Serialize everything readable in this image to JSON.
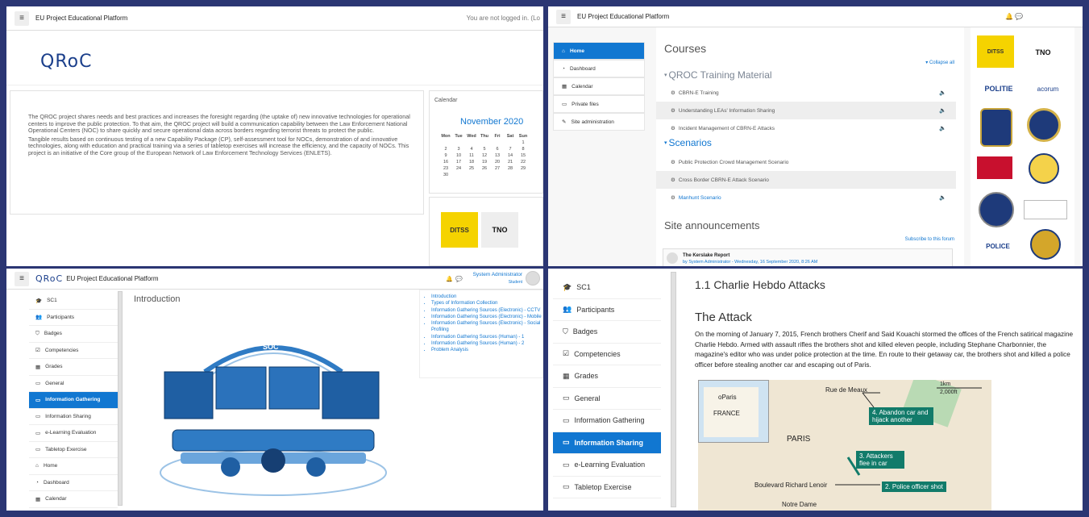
{
  "panel1": {
    "platform_title": "EU Project Educational Platform",
    "login_status": "You are not logged in. (Lo",
    "logo": "QRoC",
    "intro_p1": "The QROC project shares needs and best practices and increases the foresight regarding (the uptake of) new innovative technologies for operational centers to improve the public protection. To that aim, the QROC project will build a communication capability between the Law Enforcement National Operational Centers (NOC) to share quickly and secure operational data across borders regarding terrorist threats to protect the public.",
    "intro_p2": "Tangible results based on continuous testing of a new Capability Package (CP), self-assessment tool for NOCs, demonstration of and innovative technologies, along with education and practical training via a series of tabletop exercises will increase the efficiency, and the capacity of NOCs. This project is an initiative of the Core group of the European Network of Law Enforcement Technology Services (ENLETS).",
    "calendar_label": "Calendar",
    "month": "November 2020",
    "weekdays": [
      "Mon",
      "Tue",
      "Wed",
      "Thu",
      "Fri",
      "Sat",
      "Sun"
    ],
    "weeks": [
      [
        "",
        "",
        "",
        "",
        "",
        "",
        "1"
      ],
      [
        "2",
        "3",
        "4",
        "5",
        "6",
        "7",
        "8"
      ],
      [
        "9",
        "10",
        "11",
        "12",
        "13",
        "14",
        "15"
      ],
      [
        "16",
        "17",
        "18",
        "19",
        "20",
        "21",
        "22"
      ],
      [
        "23",
        "24",
        "25",
        "26",
        "27",
        "28",
        "29"
      ],
      [
        "30",
        "",
        "",
        "",
        "",
        "",
        ""
      ]
    ],
    "logo_ditss": "DITSS",
    "logo_tno": "TNO"
  },
  "panel2": {
    "platform_title": "EU Project Educational Platform",
    "nav": [
      {
        "label": "Home",
        "icon": "home-icon",
        "glyph": "⌂"
      },
      {
        "label": "Dashboard",
        "icon": "dashboard-icon",
        "glyph": "◔"
      },
      {
        "label": "Calendar",
        "icon": "calendar-icon",
        "glyph": "▦"
      },
      {
        "label": "Private files",
        "icon": "file-icon",
        "glyph": "▭"
      },
      {
        "label": "Site administration",
        "icon": "wrench-icon",
        "glyph": "✎"
      }
    ],
    "courses_heading": "Courses",
    "collapse_all": "▾ Collapse all",
    "section1": "QROC Training Material",
    "section1_items": [
      "CBRN-E Training",
      "Understanding LEAs' Information Sharing",
      "Incident Management of CBRN-E Attacks"
    ],
    "section2": "Scenarios",
    "section2_items": [
      "Public Protection Crowd Management Scenario",
      "Cross Border CBRN-E Attack Scenario",
      "Manhunt Scenario"
    ],
    "announcements_heading": "Site announcements",
    "subscribe": "Subscribe to this forum",
    "post_title": "The Kerslake Report",
    "post_by": "by System Administrator - Wednesday, 16 September 2020, 8:26 AM",
    "logo_ditss": "DITSS",
    "logo_tno": "TNO",
    "logo_politie": "POLITIE",
    "logo_acorum": "acorum",
    "logo_police": "POLICE"
  },
  "panel3": {
    "logo": "QRoC",
    "platform_title": "EU Project Educational Platform",
    "user_name": "System Administrator",
    "user_role": "Student",
    "nav": [
      {
        "label": "SC1",
        "icon": "graduation-cap-icon",
        "glyph": "🎓"
      },
      {
        "label": "Participants",
        "icon": "users-icon",
        "glyph": "👥"
      },
      {
        "label": "Badges",
        "icon": "shield-icon",
        "glyph": "⛉"
      },
      {
        "label": "Competencies",
        "icon": "checkbox-icon",
        "glyph": "☑"
      },
      {
        "label": "Grades",
        "icon": "table-icon",
        "glyph": "▦"
      },
      {
        "label": "General",
        "icon": "folder-icon",
        "glyph": "▭"
      },
      {
        "label": "Information Gathering",
        "icon": "folder-icon",
        "glyph": "▭"
      },
      {
        "label": "Information Sharing",
        "icon": "folder-icon",
        "glyph": "▭"
      },
      {
        "label": "e-Learning Evaluation",
        "icon": "folder-icon",
        "glyph": "▭"
      },
      {
        "label": "Tabletop Exercise",
        "icon": "folder-icon",
        "glyph": "▭"
      },
      {
        "label": "Home",
        "icon": "home-icon",
        "glyph": "⌂"
      },
      {
        "label": "Dashboard",
        "icon": "dashboard-icon",
        "glyph": "◔"
      },
      {
        "label": "Calendar",
        "icon": "calendar-icon",
        "glyph": "▦"
      }
    ],
    "content_title": "Introduction",
    "soc_label": "SOC",
    "toc": [
      "Introduction",
      "Types of Information Collection",
      "Information Gathering Sources (Electronic) - CCTV",
      "Information Gathering Sources (Electronic) - Mobile",
      "Information Gathering Sources (Electronic) - Social Profiling",
      "Information Gathering Sources (Human) - 1",
      "Information Gathering Sources (Human) - 2",
      "Problem Analysis"
    ]
  },
  "panel4": {
    "nav": [
      {
        "label": "SC1",
        "icon": "graduation-cap-icon",
        "glyph": "🎓"
      },
      {
        "label": "Participants",
        "icon": "users-icon",
        "glyph": "👥"
      },
      {
        "label": "Badges",
        "icon": "shield-icon",
        "glyph": "⛉"
      },
      {
        "label": "Competencies",
        "icon": "checkbox-icon",
        "glyph": "☑"
      },
      {
        "label": "Grades",
        "icon": "table-icon",
        "glyph": "▦"
      },
      {
        "label": "General",
        "icon": "folder-icon",
        "glyph": "▭"
      },
      {
        "label": "Information Gathering",
        "icon": "folder-icon",
        "glyph": "▭"
      },
      {
        "label": "Information Sharing",
        "icon": "folder-icon",
        "glyph": "▭"
      },
      {
        "label": "e-Learning Evaluation",
        "icon": "folder-icon",
        "glyph": "▭"
      },
      {
        "label": "Tabletop Exercise",
        "icon": "folder-icon",
        "glyph": "▭"
      }
    ],
    "page_title": "1.1 Charlie Hebdo Attacks",
    "section_title": "The Attack",
    "body": "On the morning of January 7, 2015, French brothers Cherif and Said Kouachi stormed the offices of the French satirical magazine Charlie Hebdo. Armed with assault rifles the brothers shot and killed eleven people, including Stephane Charbonnier, the magazine's editor who was under police protection at the time. En route to their getaway car, the brothers shot and killed a police officer before stealing another car and escaping out of Paris.",
    "map": {
      "rue": "Rue de Meaux",
      "paris_inset": "oParis",
      "france": "FRANCE",
      "paris": "PARIS",
      "scale_km": "1km",
      "scale_ft": "2,000ft",
      "boulevard": "Boulevard Richard Lenoir",
      "notre_dame": "Notre Dame",
      "label4": "4. Abandon car and hijack another",
      "label3": "3. Attackers flee in car",
      "label2": "2. Police officer shot"
    }
  },
  "colors": {
    "brand_blue": "#1177d1",
    "frame": "#2b3673",
    "map_teal": "#127b6a"
  }
}
